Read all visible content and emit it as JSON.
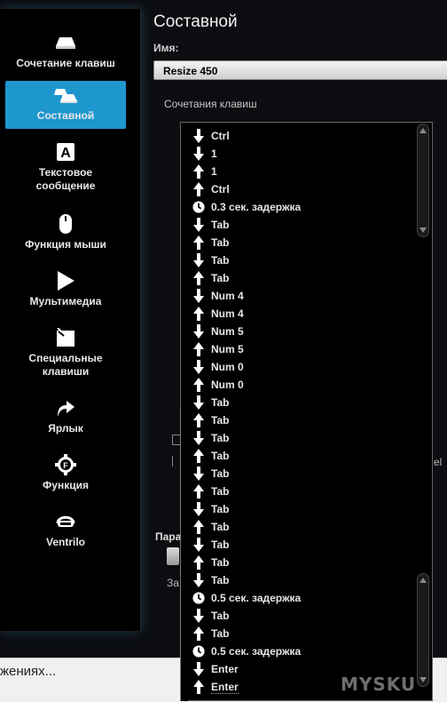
{
  "sidebar": {
    "items": [
      {
        "label": "Сочетание клавиш",
        "icon": "keycap-icon",
        "active": false
      },
      {
        "label": "Составной",
        "icon": "multi-key-icon",
        "active": true
      },
      {
        "label": "Текстовое сообщение",
        "icon": "letter-a-icon",
        "active": false
      },
      {
        "label": "Функция мыши",
        "icon": "mouse-icon",
        "active": false
      },
      {
        "label": "Мультимедиа",
        "icon": "play-icon",
        "active": false
      },
      {
        "label": "Специальные клавиши",
        "icon": "special-key-icon",
        "active": false
      },
      {
        "label": "Ярлык",
        "icon": "shortcut-arrow-icon",
        "active": false
      },
      {
        "label": "Функция",
        "icon": "function-gear-icon",
        "active": false
      },
      {
        "label": "Ventrilo",
        "icon": "headset-icon",
        "active": false
      }
    ]
  },
  "main": {
    "title": "Составной",
    "name_label": "Имя:",
    "name_value": "Resize 450",
    "sequence_label": "Сочетания клавиш",
    "hidden_params_label": "Пара",
    "hidden_text_za": "За",
    "hidden_text_el": "el"
  },
  "sequence": [
    {
      "dir": "down",
      "text": "Ctrl"
    },
    {
      "dir": "down",
      "text": "1"
    },
    {
      "dir": "up",
      "text": "1"
    },
    {
      "dir": "up",
      "text": "Ctrl"
    },
    {
      "dir": "delay",
      "text": "0.3 сек. задержка"
    },
    {
      "dir": "down",
      "text": "Tab"
    },
    {
      "dir": "up",
      "text": "Tab"
    },
    {
      "dir": "down",
      "text": "Tab"
    },
    {
      "dir": "up",
      "text": "Tab"
    },
    {
      "dir": "down",
      "text": "Num 4"
    },
    {
      "dir": "up",
      "text": "Num 4"
    },
    {
      "dir": "down",
      "text": "Num 5"
    },
    {
      "dir": "up",
      "text": "Num 5"
    },
    {
      "dir": "down",
      "text": "Num 0"
    },
    {
      "dir": "up",
      "text": "Num 0"
    },
    {
      "dir": "down",
      "text": "Tab"
    },
    {
      "dir": "up",
      "text": "Tab"
    },
    {
      "dir": "down",
      "text": "Tab"
    },
    {
      "dir": "up",
      "text": "Tab"
    },
    {
      "dir": "down",
      "text": "Tab"
    },
    {
      "dir": "up",
      "text": "Tab"
    },
    {
      "dir": "down",
      "text": "Tab"
    },
    {
      "dir": "up",
      "text": "Tab"
    },
    {
      "dir": "down",
      "text": "Tab"
    },
    {
      "dir": "up",
      "text": "Tab"
    },
    {
      "dir": "down",
      "text": "Tab"
    },
    {
      "dir": "delay",
      "text": "0.5 сек. задержка"
    },
    {
      "dir": "down",
      "text": "Tab"
    },
    {
      "dir": "up",
      "text": "Tab"
    },
    {
      "dir": "delay",
      "text": "0.5 сек. задержка"
    },
    {
      "dir": "down",
      "text": "Enter"
    },
    {
      "dir": "up",
      "text": "Enter"
    }
  ],
  "bottom": {
    "text": "жениях..."
  },
  "watermark": "MYSKU",
  "colors": {
    "accent": "#1e97cf",
    "panel": "#000000",
    "background": "#0b0d10"
  }
}
